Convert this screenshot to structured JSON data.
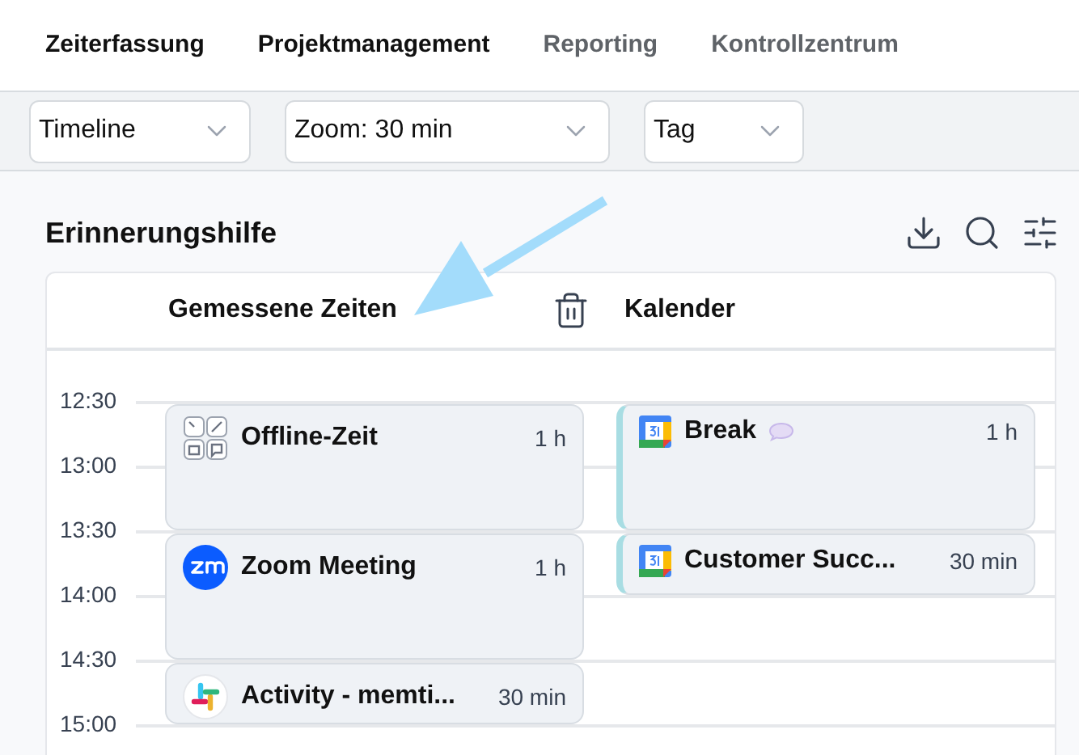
{
  "nav_tabs": [
    {
      "label": "Zeiterfassung",
      "disabled": false
    },
    {
      "label": "Projektmanagement",
      "disabled": false
    },
    {
      "label": "Reporting",
      "disabled": true
    },
    {
      "label": "Kontrollzentrum",
      "disabled": true
    }
  ],
  "filters": [
    {
      "value": "Timeline"
    },
    {
      "value": "Zoom: 30 min"
    },
    {
      "value": "Tag"
    }
  ],
  "panel": {
    "title": "Erinnerungshilfe",
    "columns": {
      "measured": "Gemessene Zeiten",
      "calendar": "Kalender"
    },
    "times": [
      "12:30",
      "13:00",
      "13:30",
      "14:00",
      "14:30",
      "15:00"
    ],
    "measured_entries": [
      {
        "kind": "offline",
        "title": "Offline-Zeit",
        "duration": "1 h",
        "long": true,
        "comment": false
      },
      {
        "kind": "zoom",
        "title": "Zoom Meeting",
        "duration": "1 h",
        "long": true,
        "comment": false
      },
      {
        "kind": "slack",
        "title": "Activity - memti...",
        "duration": "30 min",
        "long": false,
        "comment": false
      }
    ],
    "calendar_entries": [
      {
        "kind": "gcal",
        "title": "Break",
        "duration": "1 h",
        "long": true,
        "comment": true
      },
      {
        "kind": "gcal",
        "title": "Customer Succ...",
        "duration": "30 min",
        "long": false,
        "comment": false
      }
    ]
  }
}
